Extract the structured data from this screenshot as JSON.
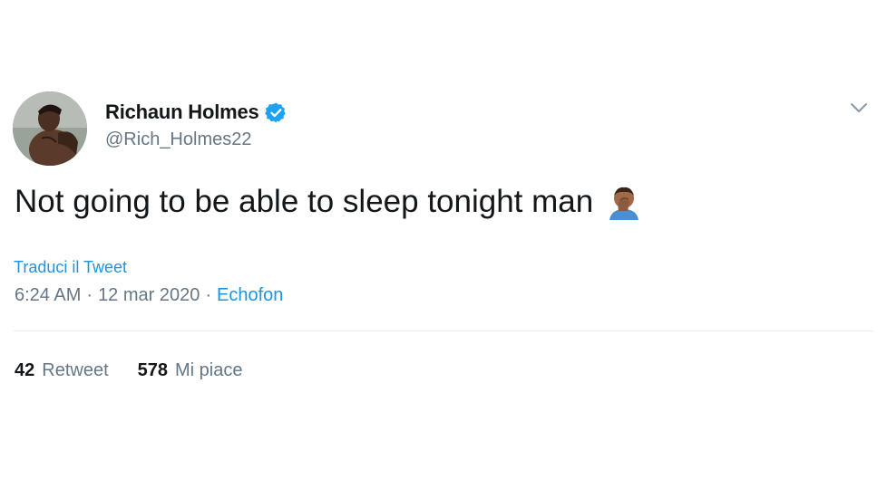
{
  "tweet": {
    "author": {
      "display_name": "Richaun Holmes",
      "handle": "@Rich_Holmes22",
      "verified": true,
      "avatar_icon": "profile-photo"
    },
    "text": "Not going to be able to sleep tonight man",
    "emoji": "facepalm-icon",
    "translate_label": "Traduci il Tweet",
    "time": "6:24 AM",
    "date": "12 mar 2020",
    "separator": "·",
    "source": "Echofon",
    "stats": {
      "retweets": {
        "count": "42",
        "label": "Retweet"
      },
      "likes": {
        "count": "578",
        "label": "Mi piace"
      }
    },
    "menu_icon": "chevron-down-icon"
  },
  "colors": {
    "text": "#14171a",
    "secondary": "#657786",
    "link": "#1b95e0",
    "verified": "#1da1f2",
    "divider": "#e6ecf0"
  }
}
